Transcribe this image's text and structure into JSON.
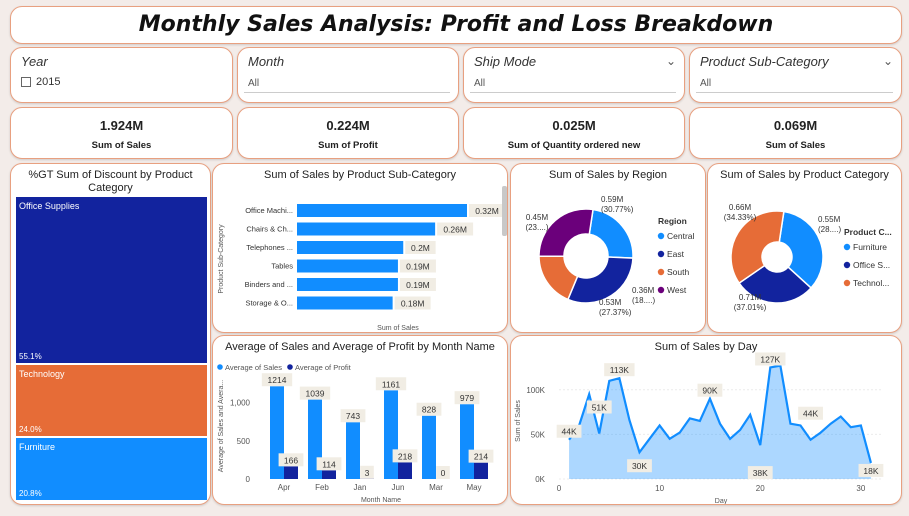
{
  "header": {
    "title": "Monthly Sales Analysis: Profit and Loss Breakdown"
  },
  "slicers": [
    {
      "label": "Year",
      "value": "2015",
      "kind": "checkbox"
    },
    {
      "label": "Month",
      "value": "All",
      "kind": "dropdown"
    },
    {
      "label": "Ship Mode",
      "value": "All",
      "kind": "dropdown"
    },
    {
      "label": "Product Sub-Category",
      "value": "All",
      "kind": "dropdown"
    }
  ],
  "kpis": [
    {
      "value": "1.924M",
      "label": "Sum of Sales"
    },
    {
      "value": "0.224M",
      "label": "Sum of Profit"
    },
    {
      "value": "0.025M",
      "label": "Sum of Quantity ordered new"
    },
    {
      "value": "0.069M",
      "label": "Sum of Sales"
    }
  ],
  "colors": {
    "navy": "#12239e",
    "blue": "#118dff",
    "orange": "#e66c37",
    "purple": "#6b007b",
    "card_border": "#e8a080"
  },
  "chart_data": [
    {
      "type": "treemap",
      "title": "%GT Sum of Discount by Product Category",
      "categories": [
        "Office Supplies",
        "Technology",
        "Furniture"
      ],
      "values": [
        55.1,
        24.0,
        20.8
      ],
      "labels": [
        "55.1%",
        "24.0%",
        "20.8%"
      ],
      "colors": [
        "#12239e",
        "#e66c37",
        "#118dff"
      ]
    },
    {
      "type": "bar",
      "orientation": "horizontal",
      "title": "Sum of Sales by Product Sub-Category",
      "ylabel": "Product Sub-Category",
      "xlabel": "Sum of Sales",
      "categories": [
        "Office Machi...",
        "Chairs & Ch...",
        "Telephones ...",
        "Tables",
        "Binders and ...",
        "Storage & O..."
      ],
      "values": [
        0.32,
        0.26,
        0.2,
        0.19,
        0.19,
        0.18
      ],
      "labels": [
        "0.32M",
        "0.26M",
        "0.2M",
        "0.19M",
        "0.19M",
        "0.18M"
      ],
      "color": "#118dff"
    },
    {
      "type": "pie",
      "title": "Sum of Sales by Region",
      "legend_title": "Region",
      "categories": [
        "Central",
        "East",
        "South",
        "West"
      ],
      "values": [
        0.45,
        0.59,
        0.36,
        0.53
      ],
      "colors": [
        "#118dff",
        "#12239e",
        "#e66c37",
        "#6b007b"
      ],
      "labels": [
        [
          "0.45M",
          "(23....)"
        ],
        [
          "0.59M",
          "(30.77%)"
        ],
        [
          "0.36M",
          "(18....)"
        ],
        [
          "0.53M",
          "(27.37%)"
        ]
      ],
      "legend": "right"
    },
    {
      "type": "pie",
      "title": "Sum of Sales by Product Category",
      "legend_title": "Product C...",
      "categories": [
        "Furniture",
        "Office S...",
        "Technol..."
      ],
      "values": [
        0.66,
        0.55,
        0.71
      ],
      "colors": [
        "#118dff",
        "#12239e",
        "#e66c37"
      ],
      "labels": [
        [
          "0.66M",
          "(34.33%)"
        ],
        [
          "0.55M",
          "(28....)"
        ],
        [
          "0.71M",
          "(37.01%)"
        ]
      ],
      "legend": "right"
    },
    {
      "type": "bar",
      "title": "Average of Sales and Average of Profit by Month Name",
      "xlabel": "Month Name",
      "ylabel": "Average of Sales and Avera...",
      "categories": [
        "Apr",
        "Feb",
        "Jan",
        "Jun",
        "Mar",
        "May"
      ],
      "series": [
        {
          "name": "Average of Sales",
          "values": [
            1214,
            1039,
            743,
            1161,
            828,
            979
          ],
          "color": "#118dff"
        },
        {
          "name": "Average of Profit",
          "values": [
            166,
            114,
            3,
            218,
            0,
            214
          ],
          "color": "#12239e"
        }
      ],
      "ylim": [
        0,
        1400
      ],
      "yticks": [
        "0",
        "500",
        "1,000"
      ],
      "legend": "top-left"
    },
    {
      "type": "area",
      "title": "Sum of Sales by Day",
      "xlabel": "Day",
      "ylabel": "Sum of Sales",
      "x": [
        1,
        2,
        3,
        4,
        5,
        6,
        7,
        8,
        9,
        10,
        11,
        12,
        13,
        14,
        15,
        16,
        17,
        18,
        19,
        20,
        21,
        22,
        23,
        24,
        25,
        26,
        27,
        28,
        29,
        30,
        31
      ],
      "values": [
        44,
        60,
        95,
        51,
        110,
        113,
        66,
        30,
        45,
        60,
        45,
        52,
        68,
        65,
        90,
        62,
        45,
        55,
        72,
        38,
        125,
        127,
        62,
        60,
        44,
        52,
        62,
        70,
        58,
        60,
        18
      ],
      "point_labels": [
        {
          "x": 1,
          "text": "44K"
        },
        {
          "x": 4,
          "text": "51K"
        },
        {
          "x": 6,
          "text": "113K"
        },
        {
          "x": 8,
          "text": "30K"
        },
        {
          "x": 15,
          "text": "90K"
        },
        {
          "x": 20,
          "text": "38K"
        },
        {
          "x": 21,
          "text": "127K"
        },
        {
          "x": 25,
          "text": "44K"
        },
        {
          "x": 31,
          "text": "18K"
        }
      ],
      "xlim": [
        0,
        32
      ],
      "ylim": [
        0,
        130
      ],
      "xticks": [
        0,
        10,
        20,
        30
      ],
      "yticks": [
        "0K",
        "50K",
        "100K"
      ],
      "color": "#118dff"
    }
  ]
}
